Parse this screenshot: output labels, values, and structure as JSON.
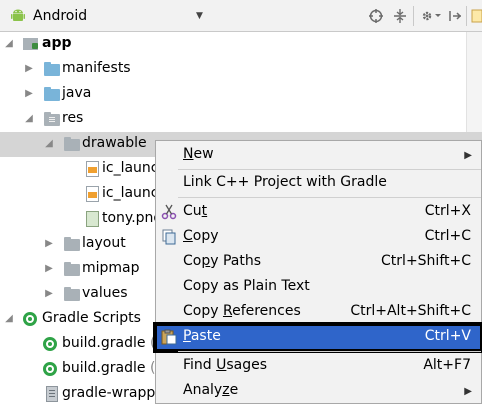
{
  "toolbar": {
    "view_mode": "Android",
    "view_mode_icon": "android-icon",
    "buttons": [
      "locate-icon",
      "collapse-icon",
      "gear-icon",
      "pin-icon"
    ]
  },
  "tree": {
    "app": "app",
    "manifests": "manifests",
    "java": "java",
    "res": "res",
    "drawable": "drawable",
    "ic_launcher_1": "ic_launch",
    "ic_launcher_2": "ic_launch",
    "tony": "tony.png",
    "layout": "layout",
    "mipmap": "mipmap",
    "values": "values",
    "gradle_scripts": "Gradle Scripts",
    "build_gradle_1": "build.gradle",
    "build_gradle_1_sub": "(",
    "build_gradle_2": "build.gradle",
    "build_gradle_2_sub": "(M",
    "gradle_wrapper": "gradle-wrappe"
  },
  "context_menu": {
    "new": {
      "pre": "",
      "mn": "N",
      "post": "ew"
    },
    "link_cpp": {
      "label": "Link C++ Project with Gradle"
    },
    "cut": {
      "pre": "Cu",
      "mn": "t",
      "post": "",
      "shortcut": "Ctrl+X"
    },
    "copy": {
      "pre": "",
      "mn": "C",
      "post": "opy",
      "shortcut": "Ctrl+C"
    },
    "copy_paths": {
      "pre": "Co",
      "mn": "p",
      "post": "y Paths",
      "shortcut": "Ctrl+Shift+C"
    },
    "copy_plain": {
      "label": "Copy as Plain Text"
    },
    "copy_refs": {
      "pre": "Copy ",
      "mn": "R",
      "post": "eferences",
      "shortcut": "Ctrl+Alt+Shift+C"
    },
    "paste": {
      "pre": "",
      "mn": "P",
      "post": "aste",
      "shortcut": "Ctrl+V"
    },
    "find_usages": {
      "pre": "Find ",
      "mn": "U",
      "post": "sages",
      "shortcut": "Alt+F7"
    },
    "analyze": {
      "pre": "Analy",
      "mn": "z",
      "post": "e"
    }
  },
  "colors": {
    "selection_highlight": "#2f65ca",
    "focus_outline": "#000000",
    "selected_row": "#d5d5d5"
  }
}
